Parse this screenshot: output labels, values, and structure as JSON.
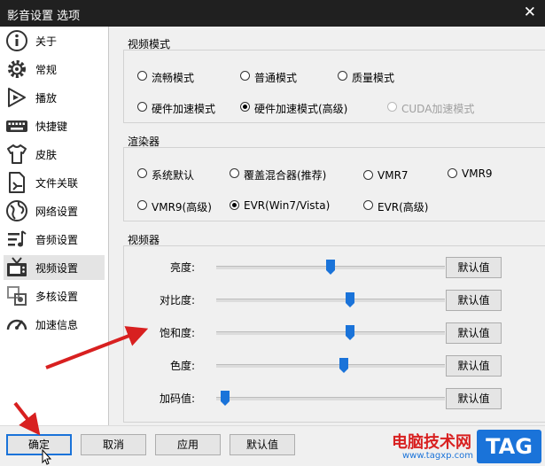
{
  "window": {
    "title": "影音设置 选项",
    "close_icon": "close-icon"
  },
  "sidebar": {
    "items": [
      {
        "label": "关于",
        "icon": "info-icon"
      },
      {
        "label": "常规",
        "icon": "gear-icon"
      },
      {
        "label": "播放",
        "icon": "play-icon"
      },
      {
        "label": "快捷键",
        "icon": "keyboard-icon"
      },
      {
        "label": "皮肤",
        "icon": "shirt-icon"
      },
      {
        "label": "文件关联",
        "icon": "file-link-icon"
      },
      {
        "label": "网络设置",
        "icon": "globe-icon"
      },
      {
        "label": "音频设置",
        "icon": "audio-icon"
      },
      {
        "label": "视频设置",
        "icon": "tv-icon"
      },
      {
        "label": "多核设置",
        "icon": "multicore-icon"
      },
      {
        "label": "加速信息",
        "icon": "speedometer-icon"
      }
    ],
    "selected": "视频设置"
  },
  "video_mode": {
    "title": "视频模式",
    "options": [
      "流畅模式",
      "普通模式",
      "质量模式",
      "硬件加速模式",
      "硬件加速模式(高级)",
      "CUDA加速模式"
    ],
    "selected": "硬件加速模式(高级)",
    "disabled": [
      "CUDA加速模式"
    ]
  },
  "renderer": {
    "title": "渲染器",
    "options": [
      "系统默认",
      "覆盖混合器(推荐)",
      "VMR7",
      "VMR9",
      "VMR9(高级)",
      "EVR(Win7/Vista)",
      "EVR(高级)"
    ],
    "selected": "EVR(Win7/Vista)"
  },
  "video_adjust": {
    "title": "视频器",
    "default_label": "默认值",
    "sliders": [
      {
        "label": "亮度:",
        "value": 0.5
      },
      {
        "label": "对比度:",
        "value": 0.59
      },
      {
        "label": "饱和度:",
        "value": 0.59
      },
      {
        "label": "色度:",
        "value": 0.56
      },
      {
        "label": "加码值:",
        "value": 0.02
      }
    ]
  },
  "footer": {
    "ok": "确定",
    "cancel": "取消",
    "apply": "应用",
    "default": "默认值"
  },
  "watermark": {
    "line1": "电脑技术网",
    "line2": "www.tagxp.com",
    "tag": "TAG"
  },
  "colors": {
    "accent": "#1a73d9",
    "arrow": "#d82020",
    "titlebar": "#202020"
  }
}
